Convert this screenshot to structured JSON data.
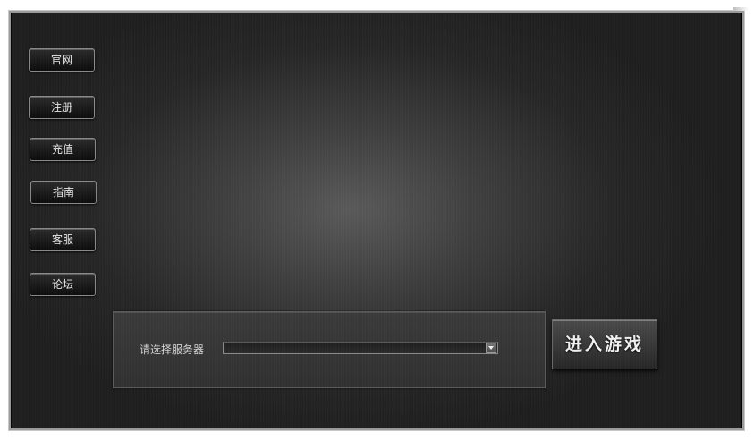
{
  "sidebar": {
    "items": [
      {
        "label": "官网"
      },
      {
        "label": "注册"
      },
      {
        "label": "充值"
      },
      {
        "label": "指南"
      },
      {
        "label": "客服"
      },
      {
        "label": "论坛"
      }
    ]
  },
  "server_panel": {
    "label": "请选择服务器",
    "selected_value": ""
  },
  "enter_button": {
    "label": "进入游戏"
  },
  "icons": {
    "dropdown": "chevron-down-icon"
  }
}
